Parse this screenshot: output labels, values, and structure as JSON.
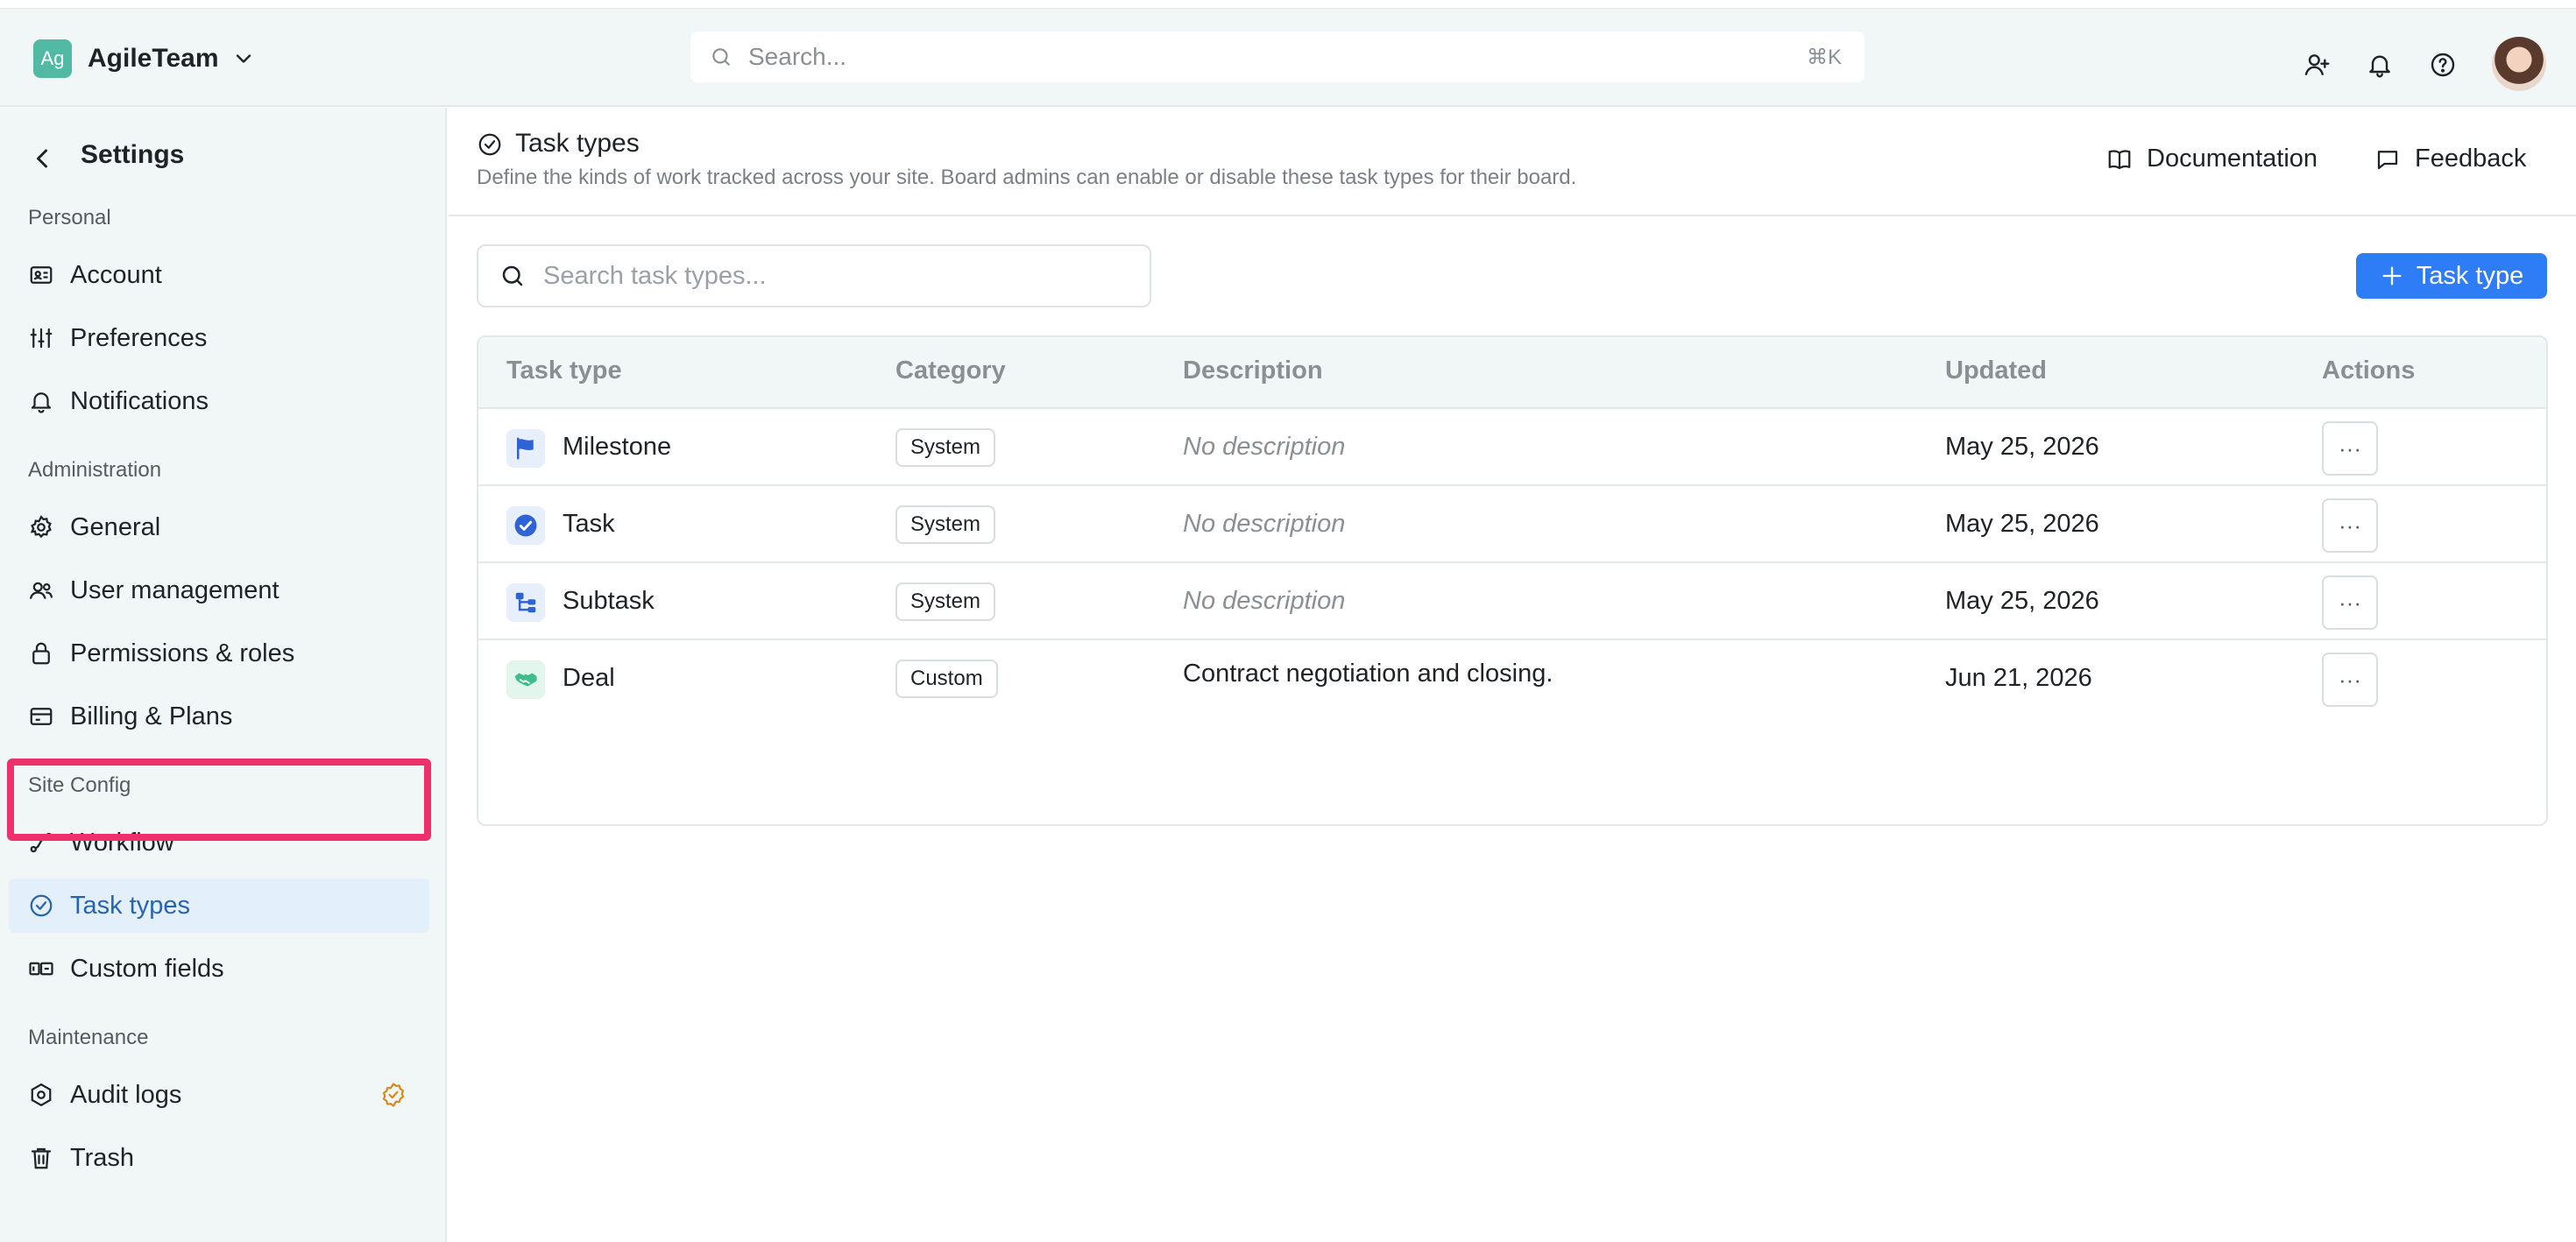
{
  "header": {
    "brand_logo": "Ag",
    "brand_name": "AgileTeam",
    "search_placeholder": "Search...",
    "search_shortcut": "⌘K",
    "icons": [
      "add-user-icon",
      "bell-icon",
      "help-icon"
    ]
  },
  "sidebar": {
    "title": "Settings",
    "sections": {
      "personal": "Personal",
      "administration": "Administration",
      "site_config": "Site Config",
      "maintenance": "Maintenance"
    },
    "items": {
      "account": "Account",
      "preferences": "Preferences",
      "notifications": "Notifications",
      "general": "General",
      "user_management": "User management",
      "permissions": "Permissions & roles",
      "billing": "Billing & Plans",
      "workflow": "Workflow",
      "task_types": "Task types",
      "custom_fields": "Custom fields",
      "audit_logs": "Audit logs",
      "trash": "Trash"
    },
    "active_item": "task_types"
  },
  "page": {
    "title": "Task types",
    "description": "Define the kinds of work tracked across your site. Board admins can enable or disable these task types for their board.",
    "documentation_label": "Documentation",
    "feedback_label": "Feedback",
    "search_placeholder": "Search task types...",
    "add_button_label": "Task type"
  },
  "table": {
    "columns": {
      "type": "Task type",
      "category": "Category",
      "description": "Description",
      "updated": "Updated",
      "actions": "Actions"
    },
    "rows": [
      {
        "name": "Milestone",
        "icon": "flag-icon",
        "category": "System",
        "description": "No description",
        "updated": "May 25, 2026",
        "actions": "···"
      },
      {
        "name": "Task",
        "icon": "check-circle-icon",
        "category": "System",
        "description": "No description",
        "updated": "May 25, 2026",
        "actions": "···"
      },
      {
        "name": "Subtask",
        "icon": "subtask-icon",
        "category": "System",
        "description": "No description",
        "updated": "May 25, 2026",
        "actions": "···"
      },
      {
        "name": "Deal",
        "icon": "handshake-icon",
        "category": "Custom",
        "description": "Contract negotiation and closing.",
        "updated": "Jun 21, 2026",
        "actions": "···"
      }
    ]
  },
  "colors": {
    "accent": "#2e7cf6",
    "active_bg": "#e3effa",
    "active_text": "#2766ad",
    "highlight": "#f0306d",
    "brand": "#52b9a5",
    "sidebar_bg": "#f1f7f6"
  }
}
